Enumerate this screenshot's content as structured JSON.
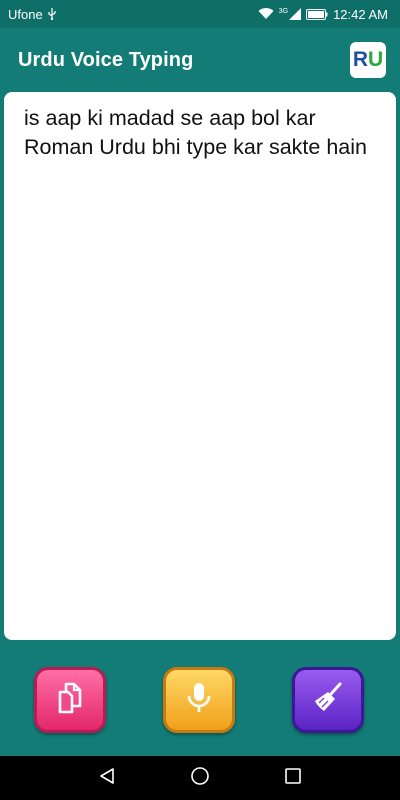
{
  "status_bar": {
    "carrier": "Ufone",
    "network": "3G",
    "time": "12:42 AM"
  },
  "app_bar": {
    "title": "Urdu Voice Typing",
    "logo_r": "R",
    "logo_u": "U"
  },
  "editor": {
    "text": "is aap ki madad se aap bol kar Roman Urdu bhi type kar sakte hain"
  },
  "actions": {
    "copy_icon": "copy-icon",
    "mic_icon": "microphone-icon",
    "clear_icon": "broom-icon"
  },
  "colors": {
    "background": "#137c76",
    "status_bar": "#0e6e68",
    "copy_button": "#e32769",
    "mic_button": "#f0a019",
    "clear_button": "#5a23c4"
  }
}
